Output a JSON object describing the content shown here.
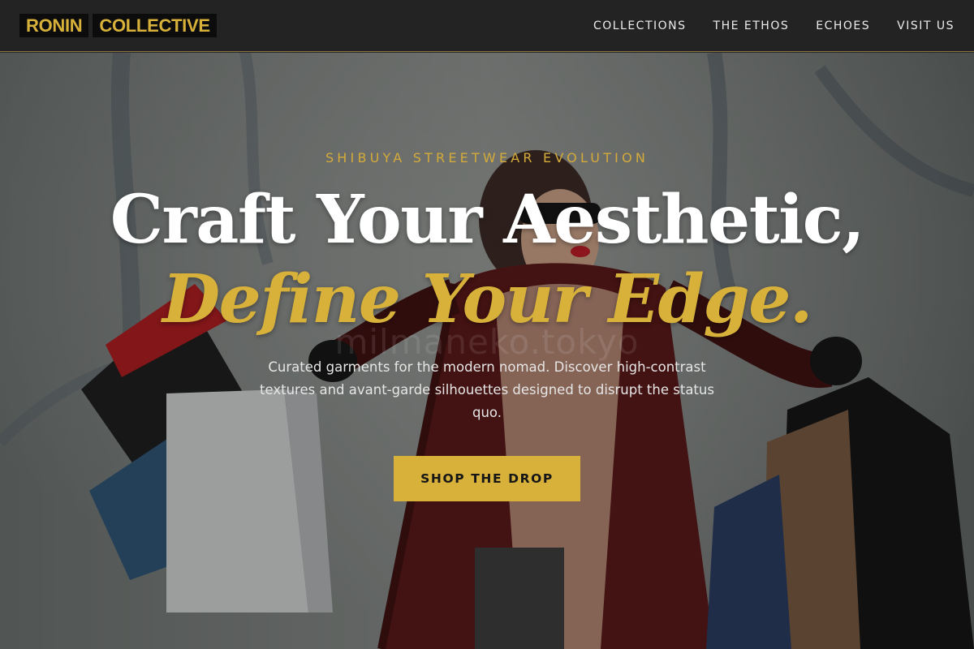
{
  "brand": {
    "name_part_1": "RONIN",
    "name_part_2": "COLLECTIVE"
  },
  "nav": {
    "items": [
      {
        "label": "COLLECTIONS"
      },
      {
        "label": "THE ETHOS"
      },
      {
        "label": "ECHOES"
      },
      {
        "label": "VISIT US"
      }
    ]
  },
  "hero": {
    "eyebrow": "SHIBUYA STREETWEAR EVOLUTION",
    "headline_line_1": "Craft Your Aesthetic,",
    "headline_line_2": "Define Your Edge.",
    "subcopy": "Curated garments for the modern nomad. Discover high-contrast textures and avant-garde silhouettes designed to disrupt the status quo.",
    "cta_label": "SHOP THE DROP",
    "image_watermark": "milmaneko.tokyo"
  },
  "colors": {
    "accent": "#d8b13b",
    "header_bg": "#232323",
    "logo_bg": "#0c0c0c",
    "headline": "#ffffff"
  }
}
